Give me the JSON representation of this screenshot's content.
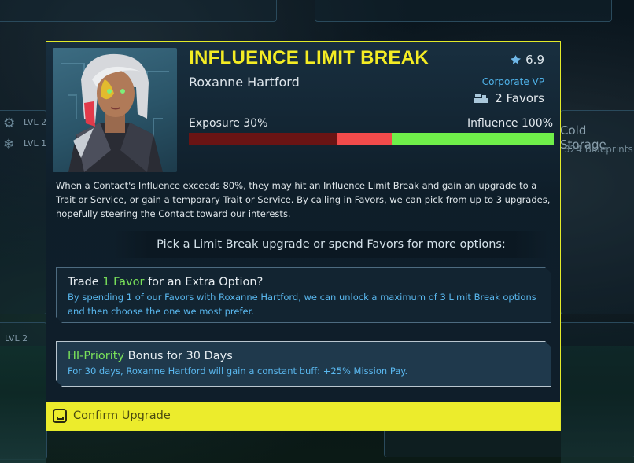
{
  "background": {
    "left_level_top": "LVL 2",
    "left_level_bottom": "LVL 1",
    "left_level_lower": "LVL 2",
    "room_name": "Cold Storage",
    "room_sub": "324 Blueprints"
  },
  "dialog": {
    "title": "INFLUENCE LIMIT BREAK",
    "contact_name": "Roxanne Hartford",
    "rating": "6.9",
    "role": "Corporate VP",
    "favors": "2 Favors",
    "exposure_label": "Exposure 30%",
    "influence_label": "Influence 100%",
    "meter": {
      "exposure": 0.3,
      "risk_end": 0.5,
      "influence": 1.0
    },
    "description": "When a Contact's Influence exceeds 80%, they may hit an Influence Limit Break and gain an upgrade to a Trait or Service, or gain a temporary Trait or Service. By calling in Favors, we can pick from up to 3 upgrades, hopefully steering the Contact toward our interests.",
    "prompt": "Pick a Limit Break upgrade or spend Favors for more options:",
    "options": [
      {
        "title_prefix": "Trade ",
        "title_highlight": "1 Favor",
        "title_suffix": " for an Extra Option?",
        "body": "By spending 1 of our Favors with Roxanne Hartford, we can unlock a maximum of 3 Limit Break options and then choose the one we most prefer."
      },
      {
        "title_prefix": "",
        "title_highlight": "HI-Priority",
        "title_suffix": " Bonus for 30 Days",
        "body": "For 30 days, Roxanne Hartford will gain a constant buff: +25% Mission Pay."
      }
    ],
    "confirm_label": "Confirm Upgrade"
  },
  "colors": {
    "accent": "#f4ec24",
    "confirm_bg": "#ecec2c",
    "highlight_green": "#7ae25a",
    "body_blue": "#5ab8ef",
    "exposure_dark": "#6a1414",
    "exposure_risk": "#f24b4b",
    "influence_green": "#6fef4a"
  }
}
